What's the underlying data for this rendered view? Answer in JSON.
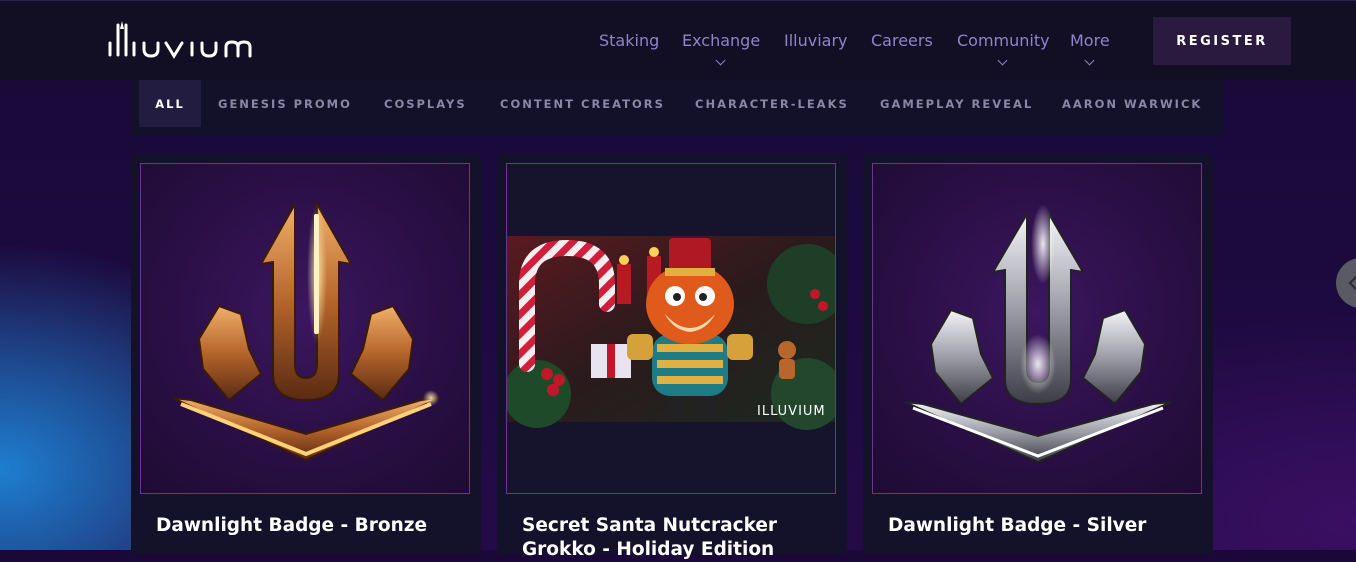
{
  "brand": {
    "logo_text": "ILLUVIUM",
    "logo_icon": "illuvium-logo-icon"
  },
  "nav": {
    "items": [
      {
        "label": "Staking",
        "has_dropdown": false
      },
      {
        "label": "Exchange",
        "has_dropdown": true
      },
      {
        "label": "Illuviary",
        "has_dropdown": false
      },
      {
        "label": "Careers",
        "has_dropdown": false
      },
      {
        "label": "Community",
        "has_dropdown": true
      },
      {
        "label": "More",
        "has_dropdown": true
      }
    ],
    "register_label": "REGISTER"
  },
  "filters": {
    "items": [
      {
        "label": "ALL",
        "active": true
      },
      {
        "label": "GENESIS PROMO",
        "active": false
      },
      {
        "label": "COSPLAYS",
        "active": false
      },
      {
        "label": "CONTENT CREATORS",
        "active": false
      },
      {
        "label": "CHARACTER-LEAKS",
        "active": false
      },
      {
        "label": "GAMEPLAY REVEAL",
        "active": false
      },
      {
        "label": "AARON WARWICK",
        "active": false
      }
    ]
  },
  "cards": [
    {
      "title": "Dawnlight Badge - Bronze",
      "image": "bronze-badge-image"
    },
    {
      "title": "Secret Santa Nutcracker Grokko - Holiday Edition",
      "image": "nutcracker-grokko-image",
      "watermark": "ILLUVIUM"
    },
    {
      "title": "Dawnlight Badge - Silver",
      "image": "silver-badge-image"
    }
  ],
  "colors": {
    "accent_purple": "#6b3596",
    "nav_text": "#8e84c9",
    "register_bg": "#2a1a3f"
  },
  "icons": {
    "side_handle": "chevron-left-icon"
  }
}
